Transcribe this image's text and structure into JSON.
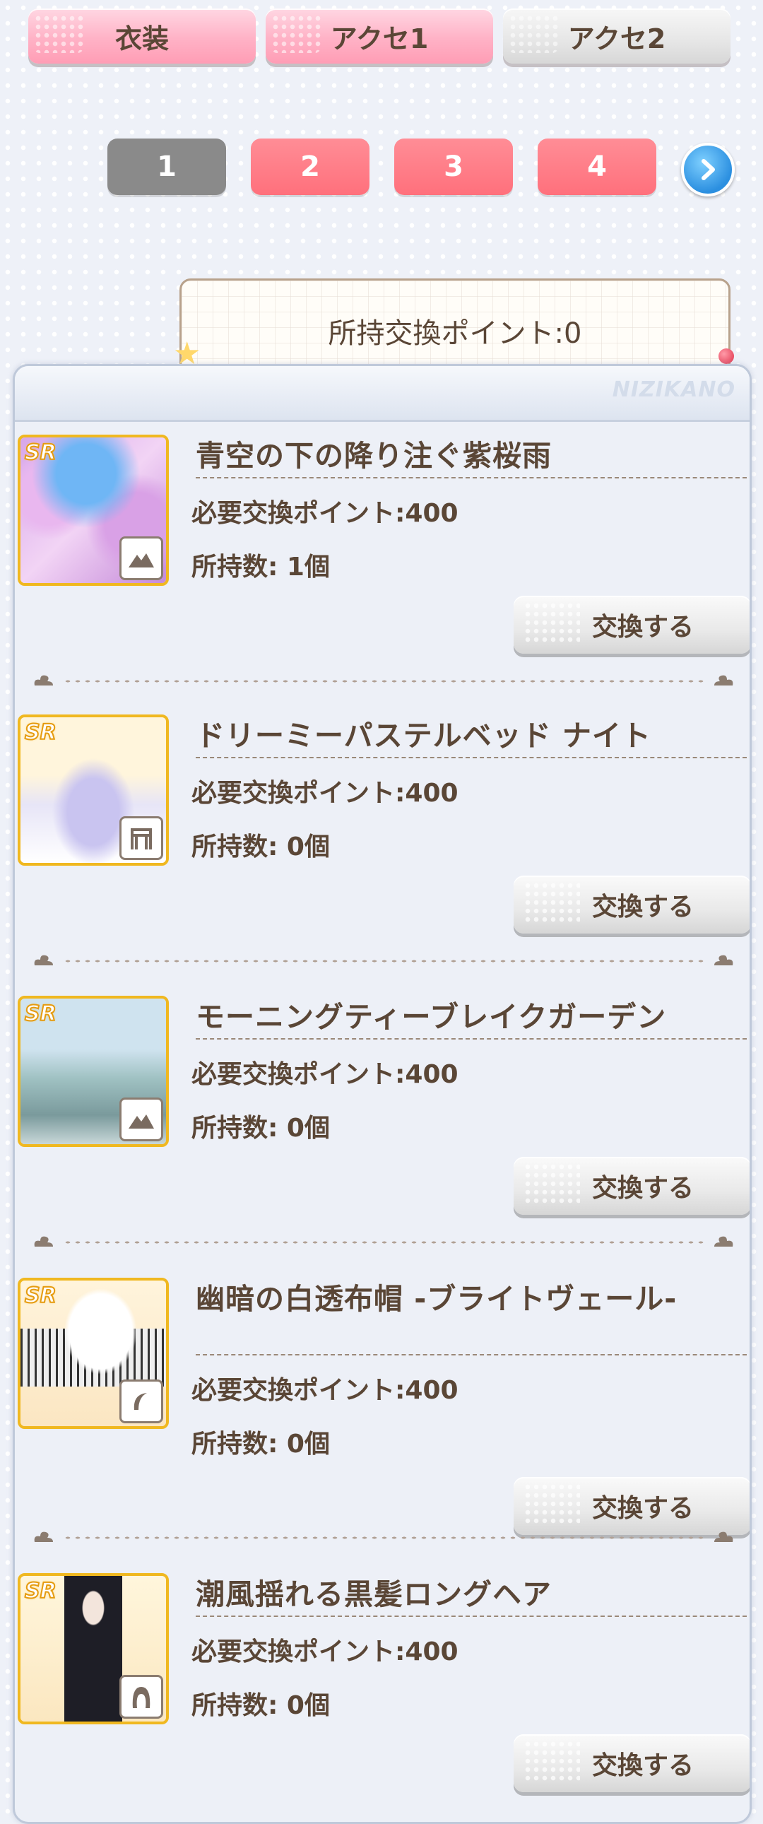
{
  "tabs": [
    {
      "label": "衣装",
      "state": "active"
    },
    {
      "label": "アクセ1",
      "state": "active"
    },
    {
      "label": "アクセ2",
      "state": "inactive"
    }
  ],
  "pagination": {
    "pages": [
      "1",
      "2",
      "3",
      "4"
    ],
    "current": "1"
  },
  "points": {
    "label": "所持交換ポイント:0"
  },
  "panel": {
    "brand": "NIZIKANO"
  },
  "items": [
    {
      "rarity": "SR",
      "name": "青空の下の降り注ぐ紫桜雨",
      "required": "必要交換ポイント:400",
      "owned": "所持数: 1個",
      "button": "交換する",
      "type_icon": "mountain-icon"
    },
    {
      "rarity": "SR",
      "name": "ドリーミーパステルベッド ナイト",
      "required": "必要交換ポイント:400",
      "owned": "所持数: 0個",
      "button": "交換する",
      "type_icon": "furniture-icon"
    },
    {
      "rarity": "SR",
      "name": "モーニングティーブレイクガーデン",
      "required": "必要交換ポイント:400",
      "owned": "所持数: 0個",
      "button": "交換する",
      "type_icon": "mountain-icon"
    },
    {
      "rarity": "SR",
      "name": "幽暗の白透布帽 -ブライトヴェール-",
      "required": "必要交換ポイント:400",
      "owned": "所持数: 0個",
      "button": "交換する",
      "type_icon": "headwear-icon"
    },
    {
      "rarity": "SR",
      "name": "潮風揺れる黒髪ロングヘア",
      "required": "必要交換ポイント:400",
      "owned": "所持数: 0個",
      "button": "交換する",
      "type_icon": "hair-icon"
    }
  ],
  "colors": {
    "tab_pink": "#ffb2c6",
    "page_current": "#8a8a8a",
    "page_other": "#ff7a85",
    "text_brown": "#5a4636",
    "rarity_gold": "#f0b820",
    "next_blue": "#2b8fe0"
  }
}
